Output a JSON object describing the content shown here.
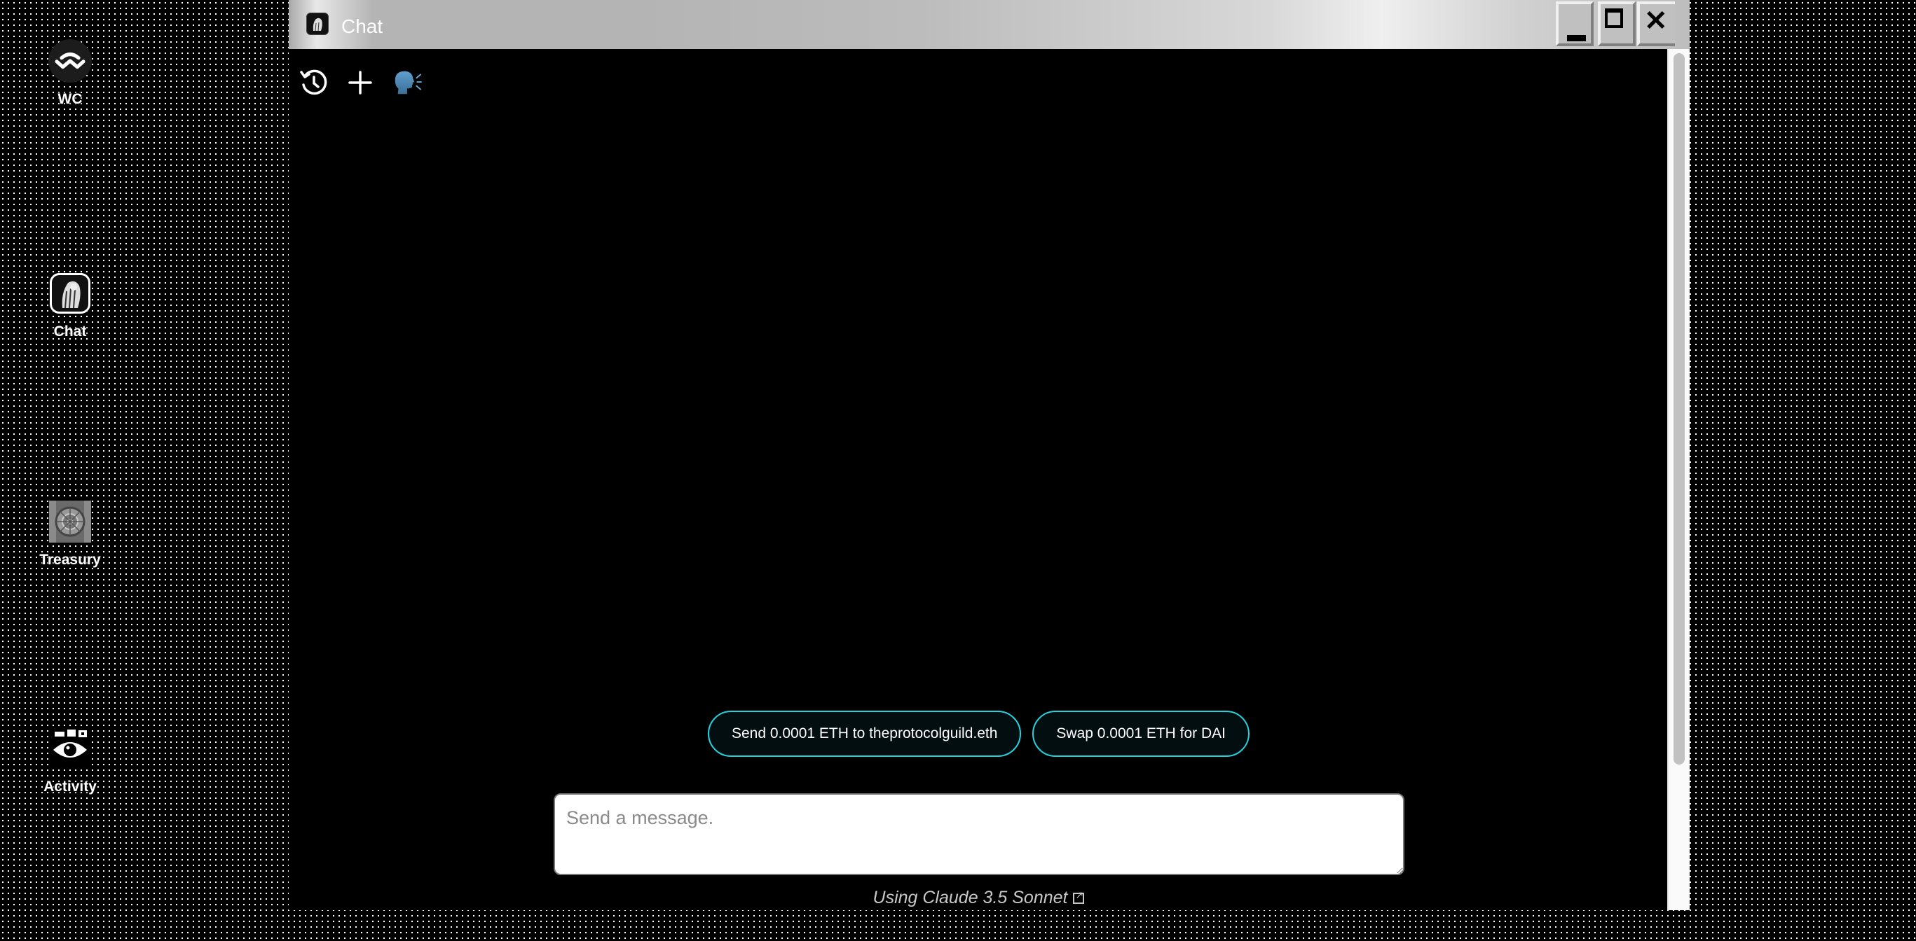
{
  "desktop": {
    "icons": [
      {
        "label": "WC",
        "icon": "walletconnect-icon"
      },
      {
        "label": "Chat",
        "icon": "chat-app-icon"
      },
      {
        "label": "Treasury",
        "icon": "treasury-icon"
      },
      {
        "label": "Activity",
        "icon": "activity-eye-icon"
      }
    ]
  },
  "window": {
    "title": "Chat",
    "controls": {
      "minimize": "minimize",
      "maximize": "maximize",
      "close": "close"
    }
  },
  "toolbar": {
    "history": "history-icon",
    "new_chat": "plus-icon",
    "voice": "speaking-head-icon",
    "voice_glyph": "🗣️"
  },
  "suggestions": [
    {
      "label": "Send 0.0001 ETH to theprotocolguild.eth"
    },
    {
      "label": "Swap 0.0001 ETH for DAI"
    }
  ],
  "composer": {
    "placeholder": "Send a message.",
    "value": ""
  },
  "footer": {
    "model_text": "Using Claude 3.5 Sonnet"
  },
  "colors": {
    "accent": "#22d3de",
    "window_bg": "#000000",
    "titlebar": "#b4b4b4"
  }
}
